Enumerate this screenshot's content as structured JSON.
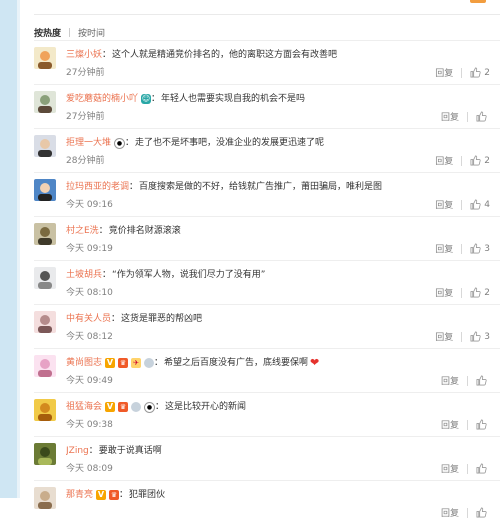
{
  "sort_tabs": [
    {
      "label": "按热度",
      "active": true
    },
    {
      "label": "按时间",
      "active": false
    }
  ],
  "action_labels": {
    "reply": "回复"
  },
  "colors": {
    "username": "#eb7350",
    "accent_bar": "#f29d3f",
    "heart": "#e5322d"
  },
  "comments": [
    {
      "user": "三燦小妖",
      "text": "这个人就是精通竞价排名的，他的离职这方面会有改善吧",
      "time": "27分钟前",
      "likes": "2",
      "avatar": "avatar-cartoon",
      "badges": []
    },
    {
      "user": "爱吃蘑菇的楠小吖",
      "text": "年轻人也需要实现自我的机会不是吗",
      "time": "27分钟前",
      "likes": "",
      "avatar": "avatar-cartoon",
      "badges": [
        "member-badge"
      ]
    },
    {
      "user": "拒理一大堆",
      "text": "走了也不是坏事吧，没准企业的发展更迅速了呢",
      "time": "28分钟前",
      "likes": "2",
      "avatar": "avatar-person",
      "badges": [
        "panda"
      ]
    },
    {
      "user": "拉玛西亚的老调",
      "text": "百度搜索是做的不好，给钱就广告推广，莆田骗局，唯利是图",
      "time": "今天 09:16",
      "likes": "4",
      "avatar": "avatar-person",
      "badges": []
    },
    {
      "user": "村之E洗",
      "text": "竞价排名财源滚滚",
      "time": "今天 09:19",
      "likes": "3",
      "avatar": "avatar-photo",
      "badges": []
    },
    {
      "user": "土坡胡兵",
      "text": "“作为领军人物，说我们尽力了没有用”",
      "time": "今天 08:10",
      "likes": "2",
      "avatar": "avatar-photo",
      "badges": []
    },
    {
      "user": "中有关人员",
      "text": "这货是罪恶的帮凶吧",
      "time": "今天 08:12",
      "likes": "3",
      "avatar": "avatar-photo",
      "badges": []
    },
    {
      "user": "黄尚图志",
      "text": "希望之后百度没有广告，底线要保啊",
      "time": "今天 09:49",
      "likes": "",
      "avatar": "avatar-photo",
      "badges": [
        "v",
        "crown",
        "rocket",
        "gem"
      ],
      "heart": "❤"
    },
    {
      "user": "祖猛海会",
      "text": "这是比较开心的新闻",
      "time": "今天 09:38",
      "likes": "",
      "avatar": "avatar-photo",
      "badges": [
        "v",
        "crown",
        "gem",
        "panda"
      ]
    },
    {
      "user": "JZing",
      "text": "要敢于说真话啊",
      "time": "今天 08:09",
      "likes": "",
      "avatar": "avatar-photo",
      "badges": []
    },
    {
      "user": "那青亮",
      "text": "犯罪团伙",
      "time": "",
      "likes": "",
      "avatar": "avatar-photo",
      "badges": [
        "v",
        "crown"
      ]
    }
  ]
}
